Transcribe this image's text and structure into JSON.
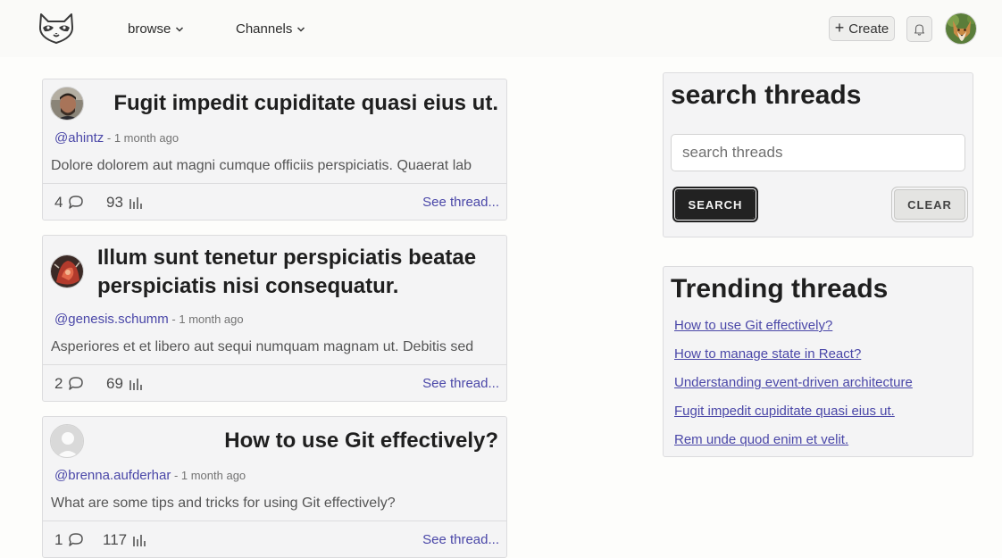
{
  "nav": {
    "browse_label": "browse",
    "channels_label": "Channels",
    "create_label": "Create"
  },
  "threads": [
    {
      "title": "Fugit impedit cupiditate quasi eius ut.",
      "username": "@ahintz",
      "time": "- 1 month ago",
      "excerpt": "Dolore dolorem aut magni cumque officiis perspiciatis. Quaerat lab",
      "comments": "4",
      "views": "93",
      "link": "See thread..."
    },
    {
      "title": "Illum sunt tenetur perspiciatis beatae perspiciatis nisi consequatur.",
      "username": "@genesis.schumm",
      "time": "- 1 month ago",
      "excerpt": "Asperiores et et libero aut sequi numquam magnam ut. Debitis sed",
      "comments": "2",
      "views": "69",
      "link": "See thread..."
    },
    {
      "title": "How to use Git effectively?",
      "username": "@brenna.aufderhar",
      "time": "- 1 month ago",
      "excerpt": "What are some tips and tricks for using Git effectively?",
      "comments": "1",
      "views": "117",
      "link": "See thread..."
    }
  ],
  "search": {
    "heading": "search threads",
    "placeholder": "search threads",
    "search_label": "SEARCH",
    "clear_label": "CLEAR"
  },
  "trending": {
    "heading": "Trending threads",
    "items": [
      "How to use Git effectively?",
      "How to manage state in React?",
      "Understanding event-driven architecture",
      "Fugit impedit cupiditate quasi eius ut.",
      "Rem unde quod enim et velit."
    ]
  },
  "icons": {
    "logo": "raccoon-logo-icon",
    "chevron": "chevron-down-icon",
    "plus": "plus-icon",
    "bell": "bell-icon",
    "comment": "comment-icon",
    "views": "bar-chart-icon"
  },
  "colors": {
    "link": "#4a47a8",
    "card_bg": "#f4f4f5",
    "primary_button": "#222222"
  }
}
